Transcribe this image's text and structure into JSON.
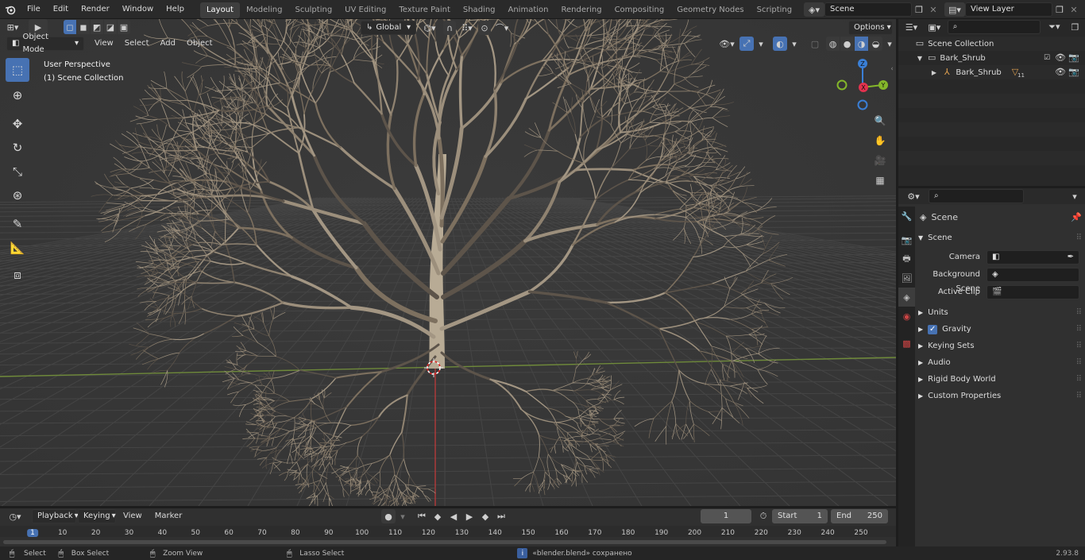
{
  "topbar": {
    "menu": [
      "File",
      "Edit",
      "Render",
      "Window",
      "Help"
    ],
    "workspaces": [
      "Layout",
      "Modeling",
      "Sculpting",
      "UV Editing",
      "Texture Paint",
      "Shading",
      "Animation",
      "Rendering",
      "Compositing",
      "Geometry Nodes",
      "Scripting"
    ],
    "active_workspace": "Layout",
    "add_tab": "+",
    "scene_name": "Scene",
    "view_layer": "View Layer"
  },
  "viewport_header": {
    "mode": "Object Mode",
    "menus": [
      "View",
      "Select",
      "Add",
      "Object"
    ],
    "transform_orientation": "Global",
    "options": "Options"
  },
  "viewport": {
    "perspective_label": "User Perspective",
    "collection_label": "(1) Scene Collection",
    "gizmo": {
      "z": "Z",
      "y": "Y",
      "x": "X"
    }
  },
  "outliner": {
    "root": "Scene Collection",
    "collection": "Bark_Shrub",
    "object": "Bark_Shrub",
    "modifier_count": "11"
  },
  "properties": {
    "context_title": "Scene",
    "panel_scene": "Scene",
    "fields": [
      {
        "label": "Camera",
        "value": ""
      },
      {
        "label": "Background Scene",
        "value": ""
      },
      {
        "label": "Active Clip",
        "value": ""
      }
    ],
    "panels": [
      "Units",
      "Gravity",
      "Keying Sets",
      "Audio",
      "Rigid Body World",
      "Custom Properties"
    ],
    "gravity_checked": true
  },
  "timeline": {
    "menus": [
      "Playback",
      "Keying",
      "View",
      "Marker"
    ],
    "current_frame": "1",
    "start_label": "Start",
    "start_value": "1",
    "end_label": "End",
    "end_value": "250",
    "ruler_ticks": [
      "1",
      "10",
      "20",
      "30",
      "40",
      "50",
      "60",
      "70",
      "80",
      "90",
      "100",
      "110",
      "120",
      "130",
      "140",
      "150",
      "160",
      "170",
      "180",
      "190",
      "200",
      "210",
      "220",
      "230",
      "240",
      "250"
    ]
  },
  "statusbar": {
    "select": "Select",
    "box_select": "Box Select",
    "zoom_view": "Zoom View",
    "lasso_select": "Lasso Select",
    "message": "«blender.blend» сохранено",
    "version": "2.93.8"
  },
  "colors": {
    "accent": "#4772b3",
    "x_axis": "#e2324e",
    "y_axis": "#84b72a",
    "z_axis": "#3a7fd6",
    "viewport_bg": "#393939",
    "branch": "#8a7d6b"
  }
}
